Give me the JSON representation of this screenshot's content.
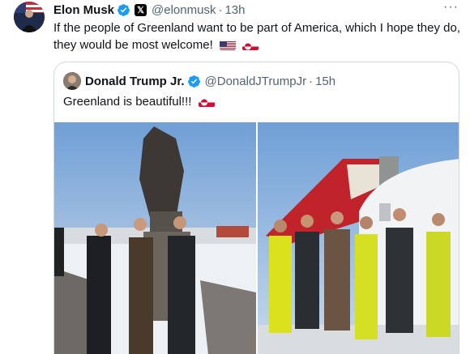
{
  "tweet": {
    "author_name": "Elon Musk",
    "author_handle": "@elonmusk",
    "separator": "·",
    "time": "13h",
    "more_icon": "···",
    "badge_label": "𝕏",
    "text": "If the people of Greenland want to be part of America, which I hope they do, they would be most welcome!"
  },
  "quote": {
    "author_name": "Donald Trump Jr.",
    "author_handle": "@DonaldJTrumpJr",
    "separator": "·",
    "time": "15h",
    "text": "Greenland is beautiful!!!"
  },
  "colors": {
    "verified_blue": "#1d9bf0",
    "muted_text": "#536471",
    "border": "#cfd9de"
  },
  "icons": [
    "verified-icon",
    "x-badge-icon",
    "us-flag-icon",
    "greenland-flag-icon",
    "more-icon"
  ]
}
